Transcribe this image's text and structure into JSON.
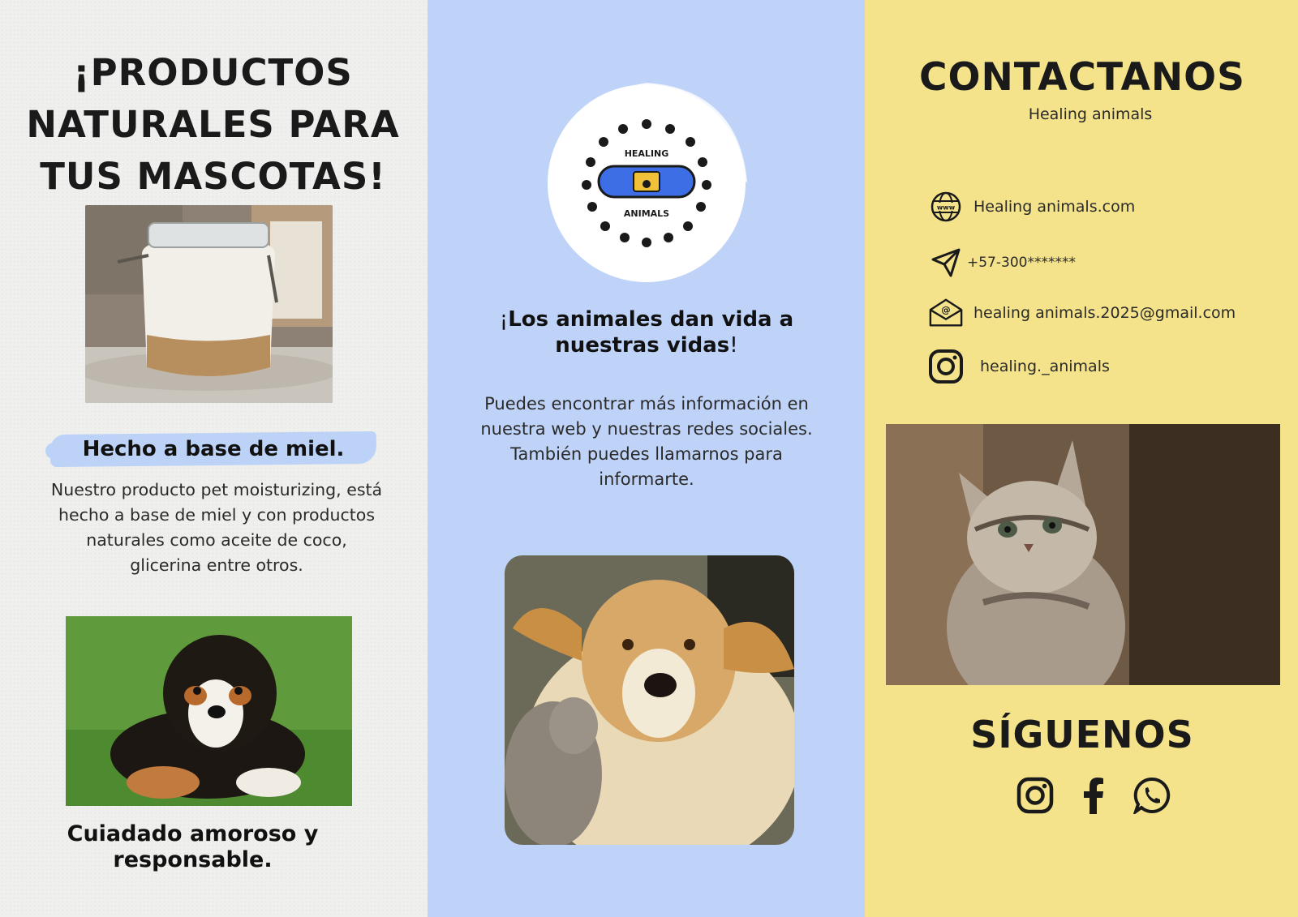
{
  "left_panel": {
    "heading": "¡PRODUCTOS NATURALES PARA TUS MASCOTAS!",
    "honey_title": "Hecho a base de miel.",
    "honey_description": "Nuestro producto pet moisturizing, está hecho a base de miel y con productos naturales como aceite de coco, glicerina entre otros.",
    "footer": "Cuiadado amoroso y responsable."
  },
  "middle_panel": {
    "logo_text_top": "HEALING",
    "logo_text_bottom": "ANIMALS",
    "tagline_open": "¡",
    "tagline_main": "Los animales dan vida a nuestras vidas",
    "tagline_close": "!",
    "description": "Puedes encontrar más información en nuestra web y nuestras redes sociales. También puedes llamarnos para informarte."
  },
  "right_panel": {
    "contact_heading": "CONTACTANOS",
    "contact_sub": "Healing animals",
    "contacts": {
      "web": {
        "icon": "globe-www-icon",
        "text": "Healing animals.com"
      },
      "phone": {
        "icon": "paper-plane-icon",
        "text": "+57-300*******"
      },
      "email": {
        "icon": "envelope-at-icon",
        "text": "healing animals.2025@gmail.com"
      },
      "instagram": {
        "icon": "instagram-icon",
        "text": "healing._animals"
      }
    },
    "follow_heading": "SÍGUENOS",
    "social_icons": [
      "instagram-icon",
      "facebook-icon",
      "whatsapp-icon"
    ]
  },
  "colors": {
    "left_bg": "#efefed",
    "middle_bg": "#bfd3f8",
    "right_bg": "#f4e38b",
    "logo_blue": "#3e6ee6",
    "text_dark": "#1a1a1a"
  }
}
